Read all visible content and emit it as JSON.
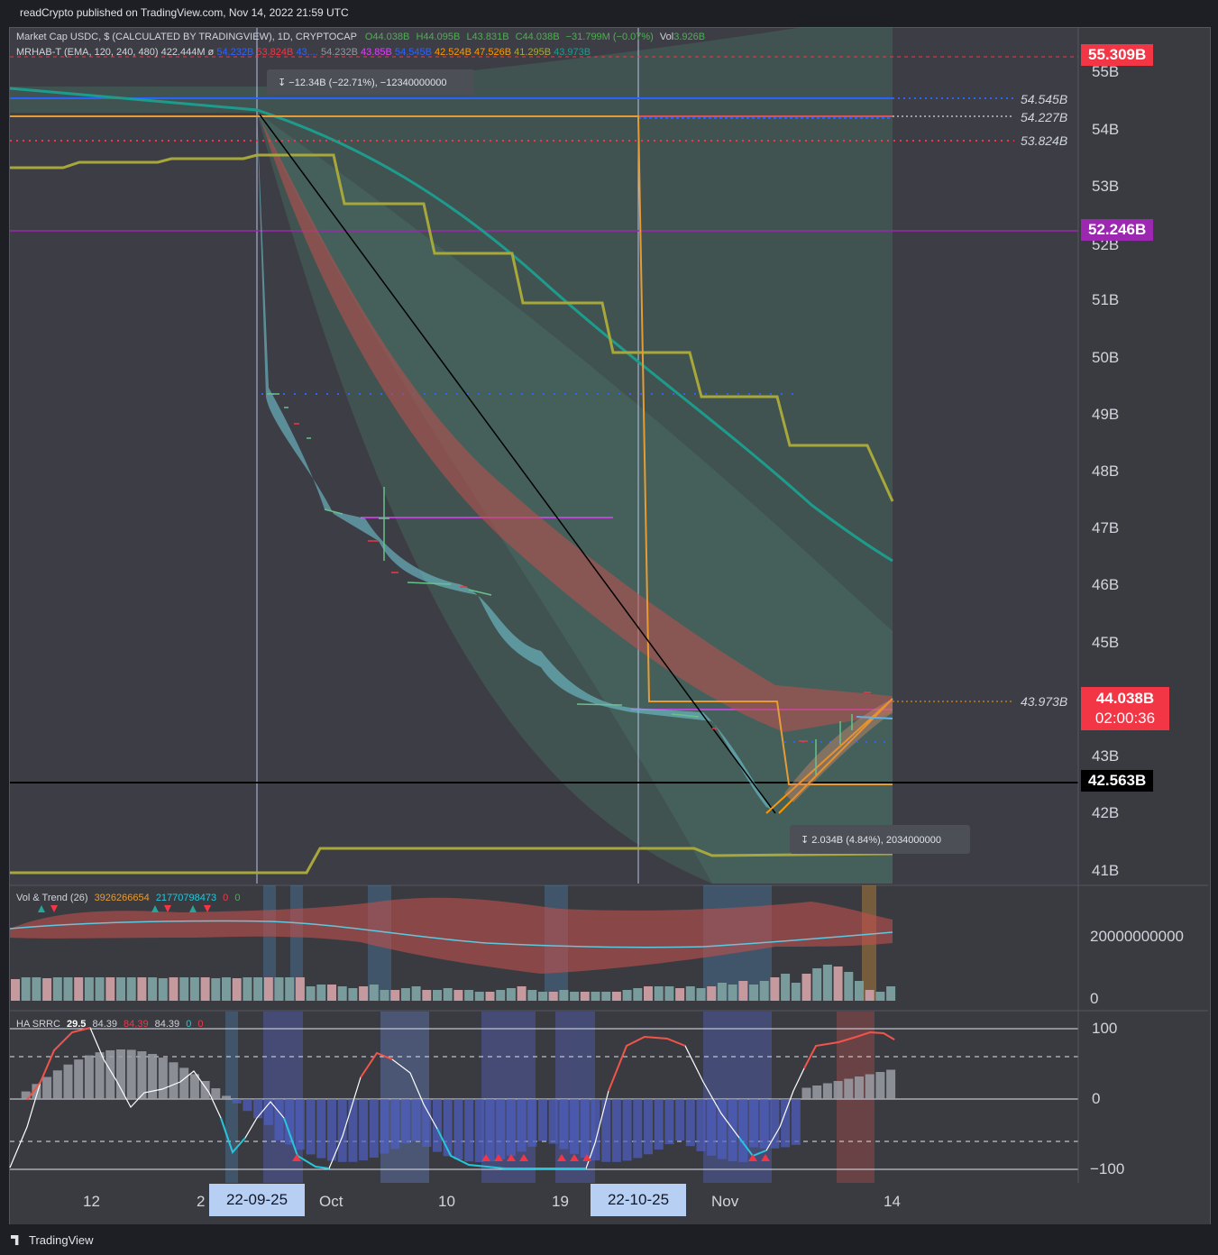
{
  "header": {
    "publish_line": "readCrypto published on TradingView.com, Nov 14, 2022 21:59 UTC"
  },
  "legend": {
    "symbol_line": "Market Cap USDC, $ (CALCULATED BY TRADINGVIEW), 1D, CRYPTOCAP",
    "ohlc": {
      "o": "O44.038B",
      "h": "H44.095B",
      "l": "L43.831B",
      "c": "C44.038B",
      "chg": "−31.799M (−0.07%)",
      "vol_label": "Vol",
      "vol": "3.926B"
    },
    "mrhab_line": "MRHAB-T (EMA, 120, 240, 480)  422.444M  ø",
    "mrhab_values": [
      "54.232B",
      "53.824B",
      "43.... ",
      "54.232B",
      "43.85B",
      "54.545B",
      "42.524B",
      "47.526B",
      "41.295B",
      "43.973B"
    ]
  },
  "measures": {
    "top": "−12.34B (−22.71%), −12340000000",
    "bottom": "2.034B (4.84%), 2034000000"
  },
  "price_axis": {
    "ticks": [
      "55B",
      "54B",
      "53B",
      "52B",
      "51B",
      "50B",
      "49B",
      "48B",
      "47B",
      "46B",
      "45B",
      "43B",
      "42B",
      "41B"
    ],
    "line_labels": [
      "54.545B",
      "54.227B",
      "53.824B",
      "43.973B"
    ],
    "badges": {
      "high": {
        "text": "55.309B",
        "color": "#f23645"
      },
      "purple": {
        "text": "52.246B",
        "color": "#9c27b0"
      },
      "last": {
        "text": "44.038B",
        "countdown": "02:00:36",
        "color": "#f23645"
      },
      "black": {
        "text": "42.563B",
        "color": "#000000"
      }
    }
  },
  "volume_pane": {
    "title": "Vol & Trend (26)",
    "v1": "3926266654",
    "v2": "21770798473",
    "v3": "0",
    "v4": "0",
    "axis": [
      "20000000000",
      "0"
    ]
  },
  "srrc_pane": {
    "title": "HA SRRC",
    "v1": "29.5",
    "v2": "84.39",
    "v3": "84.39",
    "v4": "84.39",
    "v5": "0",
    "v6": "0",
    "axis": [
      "100",
      "0",
      "−100"
    ]
  },
  "time_axis": {
    "labels": [
      "12",
      "2",
      "Oct",
      "10",
      "19",
      "Nov",
      "14"
    ],
    "highlighted": [
      "22-09-25",
      "22-10-25"
    ]
  },
  "footer": {
    "brand": "TradingView"
  }
}
